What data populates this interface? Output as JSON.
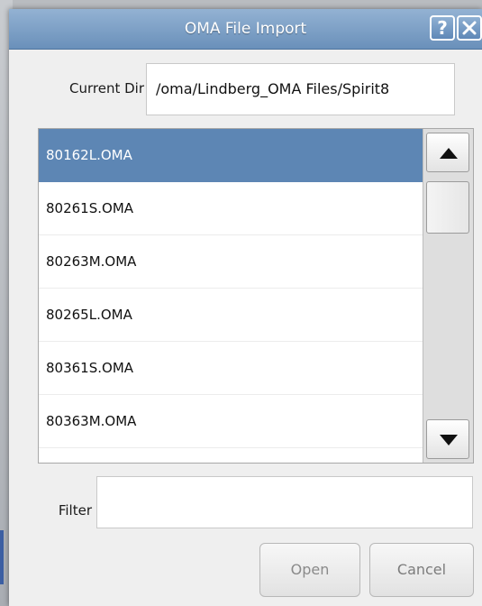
{
  "window": {
    "title": "OMA File Import",
    "help_label": "?"
  },
  "current_dir": {
    "label": "Current Dir",
    "value": "/oma/Lindberg_OMA Files/Spirit8"
  },
  "file_list": {
    "selected_index": 0,
    "items": [
      {
        "label": "80162L.OMA"
      },
      {
        "label": "80261S.OMA"
      },
      {
        "label": "80263M.OMA"
      },
      {
        "label": "80265L.OMA"
      },
      {
        "label": "80361S.OMA"
      },
      {
        "label": "80363M.OMA"
      }
    ]
  },
  "filter": {
    "label": "Filter",
    "value": ""
  },
  "buttons": {
    "open": "Open",
    "cancel": "Cancel"
  },
  "icons": {
    "help": "help-icon",
    "close": "close-icon",
    "scroll_up": "arrow-up-icon",
    "scroll_down": "arrow-down-icon"
  },
  "colors": {
    "titlebar": "#6a90ba",
    "selection": "#5d86b4"
  }
}
